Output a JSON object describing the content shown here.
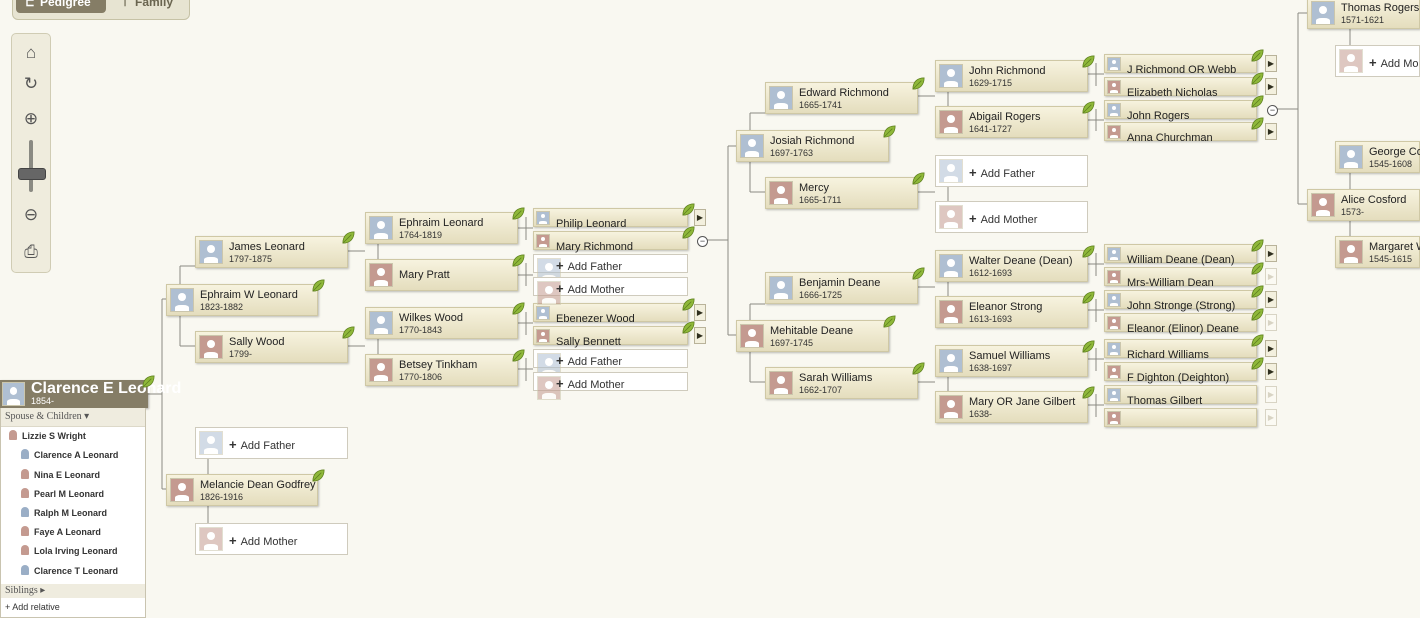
{
  "view_tabs": [
    {
      "label": "Pedigree",
      "active": true
    },
    {
      "label": "Family",
      "active": false
    }
  ],
  "tools": [
    {
      "name": "home-icon",
      "glyph": "⌂"
    },
    {
      "name": "refresh-icon",
      "glyph": "↻"
    },
    {
      "name": "zoom-in-icon",
      "glyph": "⊕"
    },
    {
      "name": "zoom-out-icon",
      "glyph": "⊖"
    },
    {
      "name": "print-icon",
      "glyph": "⎙"
    }
  ],
  "root": {
    "name": "Clarence E Leonard",
    "dates": "1854-"
  },
  "spouse_panel": {
    "header": "Spouse & Children ▾",
    "spouse": "Lizzie S Wright",
    "children": [
      "Clarence A Leonard",
      "Nina E Leonard",
      "Pearl M Leonard",
      "Ralph M Leonard",
      "Faye A Leonard",
      "Lola Irving Leonard",
      "Clarence T Leonard"
    ],
    "siblings": "Siblings ▸",
    "add_relative": "+ Add relative"
  },
  "add_labels": {
    "father": "Add Father",
    "mother": "Add Mother"
  },
  "people": {
    "ephraim_w": {
      "name": "Ephraim W Leonard",
      "dates": "1823-1882"
    },
    "melancie": {
      "name": "Melancie Dean Godfrey",
      "dates": "1826-1916"
    },
    "james": {
      "name": "James Leonard",
      "dates": "1797-1875"
    },
    "sally_wood": {
      "name": "Sally Wood",
      "dates": "1799-"
    },
    "ephraim": {
      "name": "Ephraim Leonard",
      "dates": "1764-1819"
    },
    "mary_pratt": {
      "name": "Mary Pratt",
      "dates": ""
    },
    "wilkes": {
      "name": "Wilkes Wood",
      "dates": "1770-1843"
    },
    "betsey": {
      "name": "Betsey Tinkham",
      "dates": "1770-1806"
    },
    "philip": {
      "name": "Philip Leonard",
      "dates": ""
    },
    "mary_richmond": {
      "name": "Mary Richmond",
      "dates": ""
    },
    "ebenezer": {
      "name": "Ebenezer Wood",
      "dates": ""
    },
    "sally_bennett": {
      "name": "Sally Bennett",
      "dates": ""
    },
    "josiah": {
      "name": "Josiah Richmond",
      "dates": "1697-1763"
    },
    "mehitable": {
      "name": "Mehitable Deane",
      "dates": "1697-1745"
    },
    "edward": {
      "name": "Edward Richmond",
      "dates": "1665-1741"
    },
    "mercy": {
      "name": "Mercy",
      "dates": "1665-1711"
    },
    "benjamin": {
      "name": "Benjamin Deane",
      "dates": "1666-1725"
    },
    "sarah": {
      "name": "Sarah Williams",
      "dates": "1662-1707"
    },
    "john_richmond": {
      "name": "John Richmond",
      "dates": "1629-1715"
    },
    "abigail": {
      "name": "Abigail Rogers",
      "dates": "1641-1727"
    },
    "walter": {
      "name": "Walter Deane (Dean)",
      "dates": "1612-1693"
    },
    "eleanor": {
      "name": "Eleanor Strong",
      "dates": "1613-1693"
    },
    "samuel": {
      "name": "Samuel Williams",
      "dates": "1638-1697"
    },
    "mary_gilbert": {
      "name": "Mary OR Jane Gilbert",
      "dates": "1638-"
    },
    "j_richmond_webb": {
      "name": "J Richmond OR Webb",
      "dates": ""
    },
    "elizabeth": {
      "name": "Elizabeth Nicholas",
      "dates": ""
    },
    "john_rogers": {
      "name": "John Rogers",
      "dates": ""
    },
    "anna": {
      "name": "Anna Churchman",
      "dates": ""
    },
    "william_deane": {
      "name": "William Deane (Dean)",
      "dates": ""
    },
    "mrs_william": {
      "name": "Mrs-William Dean",
      "dates": ""
    },
    "john_stronge": {
      "name": "John Stronge (Strong)",
      "dates": ""
    },
    "eleanor_elinor": {
      "name": "Eleanor (Elinor) Deane",
      "dates": ""
    },
    "richard": {
      "name": "Richard Williams",
      "dates": ""
    },
    "f_dighton": {
      "name": "F Dighton (Deighton)",
      "dates": ""
    },
    "thomas_gilbert": {
      "name": "Thomas Gilbert",
      "dates": ""
    },
    "unknown": {
      "name": "",
      "dates": ""
    },
    "thomas_rogers": {
      "name": "Thomas Rogers",
      "dates": "1571-1621"
    },
    "add_mo_partial": {
      "name": "Add Mo",
      "dates": ""
    },
    "george": {
      "name": "George Co",
      "dates": "1545-1608"
    },
    "alice": {
      "name": "Alice Cosford",
      "dates": "1573-"
    },
    "margaret": {
      "name": "Margaret W",
      "dates": "1545-1615"
    }
  },
  "colors": {
    "card_top": "#f7f3df",
    "card_bottom": "#e4ddbd",
    "root_bg": "#857d66",
    "male_photo": "#afbfd2",
    "female_photo": "#c49a90",
    "leaf": "#8fb83a"
  }
}
